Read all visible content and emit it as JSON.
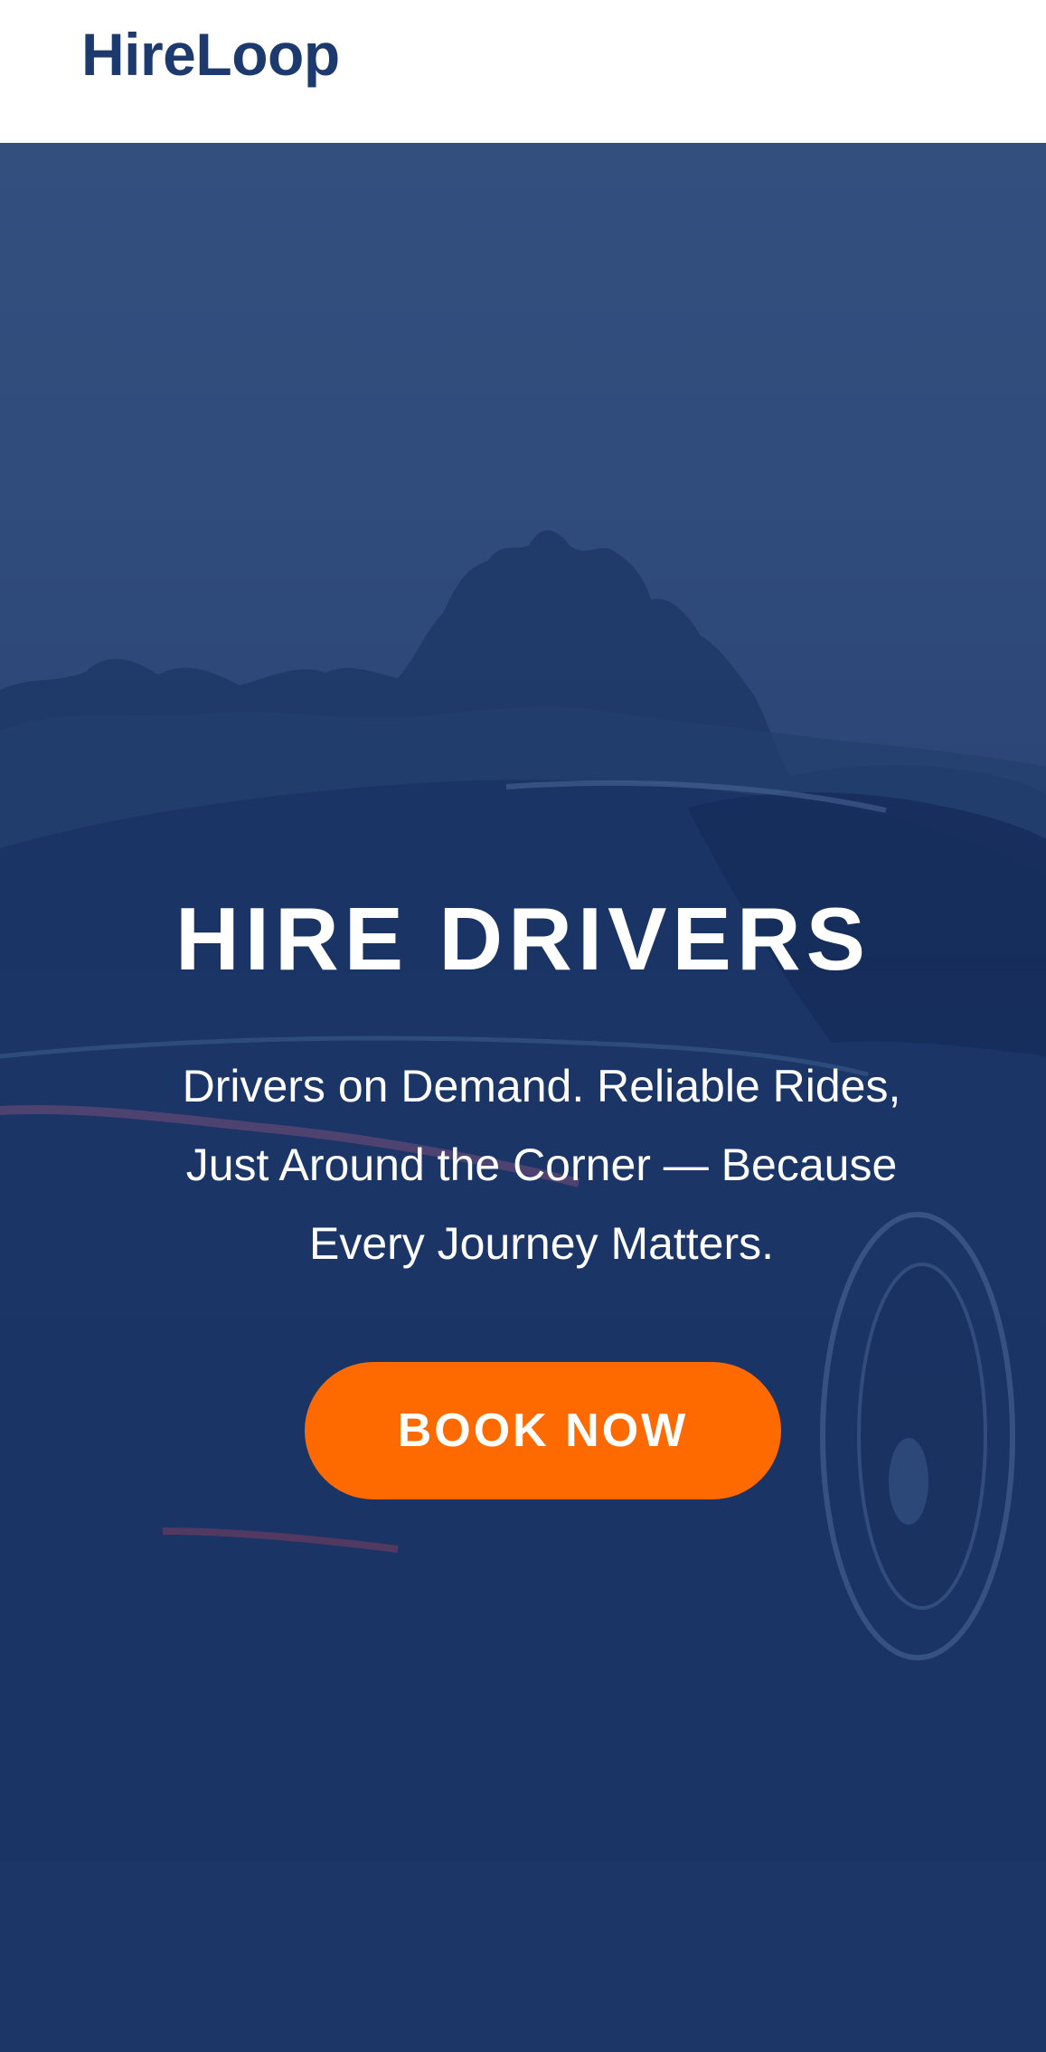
{
  "header": {
    "logo_text": "HireLoop"
  },
  "hero": {
    "title": "HIRE DRIVERS",
    "subtitle": "Drivers on Demand. Reliable Rides, Just Around the Corner — Because Every Journey Matters.",
    "cta_label": "BOOK NOW",
    "background_image": "car-with-trees-photo"
  },
  "colors": {
    "brand": "#1c3a6e",
    "overlay": "#1b3566",
    "accent": "#ff6a00",
    "text_on_dark": "#ffffff"
  }
}
